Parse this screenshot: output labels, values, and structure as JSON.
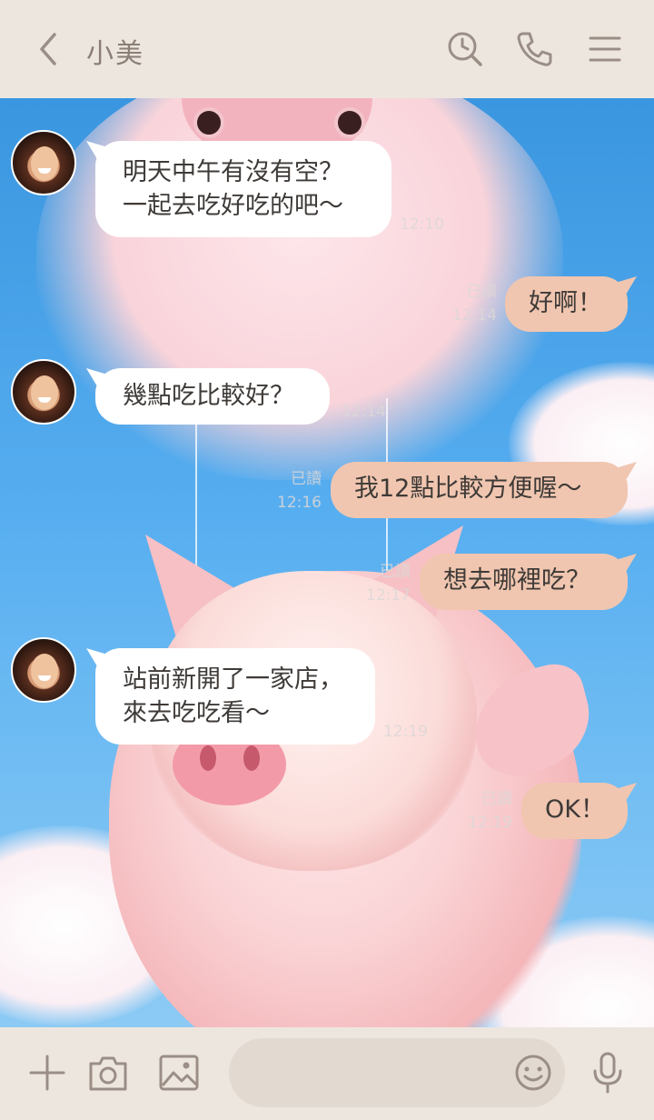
{
  "header": {
    "title": "小美",
    "back_icon": "chevron-left-icon",
    "icons": [
      "search-clock-icon",
      "phone-icon",
      "menu-icon"
    ],
    "icon_color": "#9a8e86"
  },
  "messages": [
    {
      "side": "in",
      "text_lines": [
        "明天中午有沒有空？",
        "一起去吃好吃的吧～"
      ],
      "time": "12:10"
    },
    {
      "side": "out",
      "text_lines": [
        "好啊！"
      ],
      "read": "已讀",
      "time": "12:14"
    },
    {
      "side": "in",
      "text_lines": [
        "幾點吃比較好？"
      ],
      "time": "12:14"
    },
    {
      "side": "out",
      "text_lines": [
        "我12點比較方便喔～"
      ],
      "read": "已讀",
      "time": "12:16"
    },
    {
      "side": "out",
      "text_lines": [
        "想去哪裡吃？"
      ],
      "read": "已讀",
      "time": "12:17"
    },
    {
      "side": "in",
      "text_lines": [
        "站前新開了一家店，",
        "來去吃吃看～"
      ],
      "time": "12:19"
    },
    {
      "side": "out",
      "text_lines": [
        "OK！"
      ],
      "read": "已讀",
      "time": "12:19"
    }
  ],
  "footer": {
    "icons": [
      "plus-icon",
      "camera-icon",
      "image-icon",
      "emoji-icon",
      "microphone-icon"
    ],
    "input_value": ""
  },
  "colors": {
    "header_bg": "#ede6df",
    "outgoing_bubble": "#f0c6b0",
    "incoming_bubble": "#ffffff",
    "sky": "#4aa3ea"
  }
}
